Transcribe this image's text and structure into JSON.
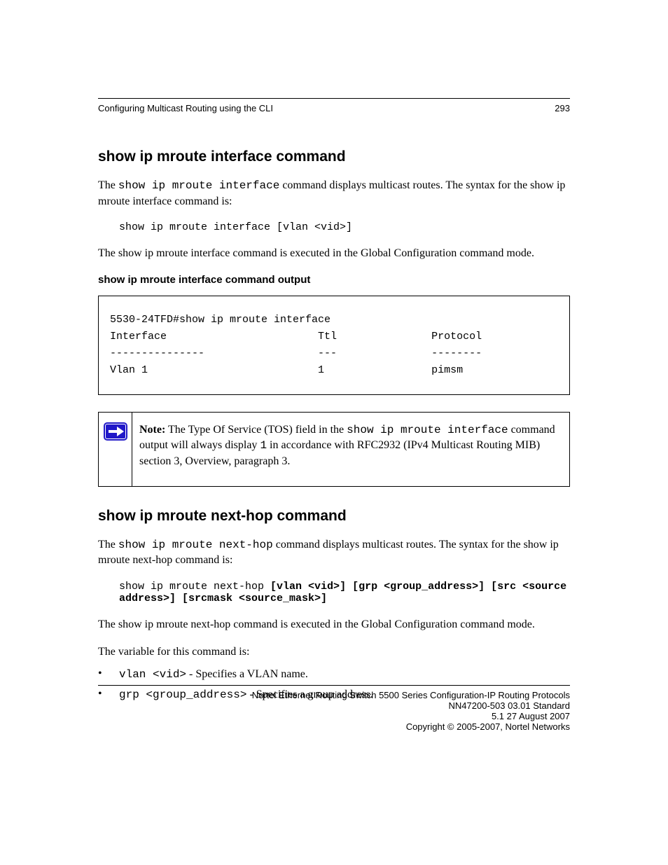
{
  "header": {
    "left": "Configuring Multicast Routing using the CLI",
    "right": "293"
  },
  "section": {
    "title": "show ip mroute interface command",
    "intro": "The ",
    "cmd_inline": "show ip mroute interface",
    "intro_tail": " command displays multicast routes. The syntax for the show ip mroute interface command is:",
    "cmd_block": "show ip mroute interface [vlan <vid>]",
    "cmd_context": "The show ip mroute interface command is executed in the Global Configuration command mode."
  },
  "output_block": {
    "title": "show ip mroute interface command output",
    "lines": [
      "5530-24TFD#show ip mroute interface",
      "Interface                        Ttl               Protocol",
      "---------------                  ---               --------",
      "Vlan 1                           1                 pimsm"
    ]
  },
  "note": {
    "label": "Note:",
    "text": " The Type Of Service (TOS) field in the ",
    "cmd": "show ip mroute interface",
    "text2": " command output will always display ",
    "val": "1",
    "text3": " in accordance with RFC2932 (IPv4 Multicast Routing MIB) section 3, Overview, paragraph 3."
  },
  "section2": {
    "title": "show ip mroute next-hop command",
    "intro": "The ",
    "cmd_inline": "show ip mroute next-hop",
    "intro_tail": " command displays multicast routes. The syntax for the show ip mroute next-hop command is:",
    "cmd_block_prefix": "show ip mroute next-hop ",
    "cmd_block_args": "[vlan <vid>] [grp <group_address>] [src <source address>] [srcmask <source_mask>]",
    "cmd_context": "The show ip mroute next-hop command is executed in the Global Configuration command mode.",
    "vars_intro": "The variable for this command is:",
    "vars": [
      {
        "bullet": "•",
        "name": "vlan <vid>",
        "desc": " - Specifies a VLAN name."
      },
      {
        "bullet": "•",
        "name": "grp <group_address>",
        "desc": " - Specifies a group address."
      }
    ]
  },
  "footer": {
    "text_part1": "Nortel Ethernet Routing Switch 5500 Series Configuration-IP Routing Protocols",
    "doc_id": "NN47200-503 03.01 Standard",
    "version_date": "5.1 27 August 2007",
    "copyright": "Copyright © 2005-2007, Nortel Networks"
  }
}
